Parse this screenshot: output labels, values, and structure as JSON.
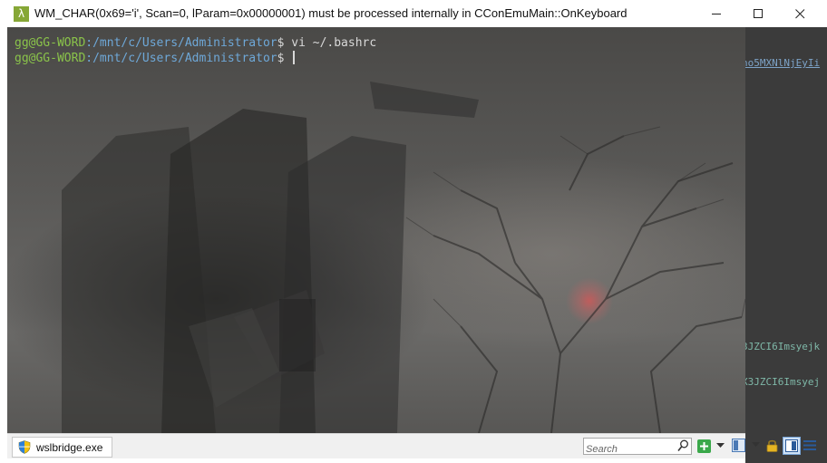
{
  "window": {
    "title": "WM_CHAR(0x69='i', Scan=0, lParam=0x00000001) must be processed internally in CConEmuMain::OnKeyboard",
    "app_icon_glyph": "λ",
    "accent_color": "#86a736"
  },
  "terminal": {
    "lines": [
      {
        "user": "gg@GG-WORD",
        "path": ":/mnt/c/Users/Administrator",
        "prompt": "$ ",
        "command": "vi ~/.bashrc"
      },
      {
        "user": "gg@GG-WORD",
        "path": ":/mnt/c/Users/Administrator",
        "prompt": "$ ",
        "command": ""
      }
    ],
    "colors": {
      "user": "#8ac34a",
      "path": "#6ea8d8",
      "text": "#d8d8d8"
    }
  },
  "background_window": {
    "lines": [
      "no5MXNlNjEyIi",
      "3JZCI6Imsyejk",
      "X3JZCI6Imsyej"
    ]
  },
  "statusbar": {
    "tab_label": "wslbridge.exe",
    "tab_icon": "shield-icon",
    "search_placeholder": "Search"
  }
}
